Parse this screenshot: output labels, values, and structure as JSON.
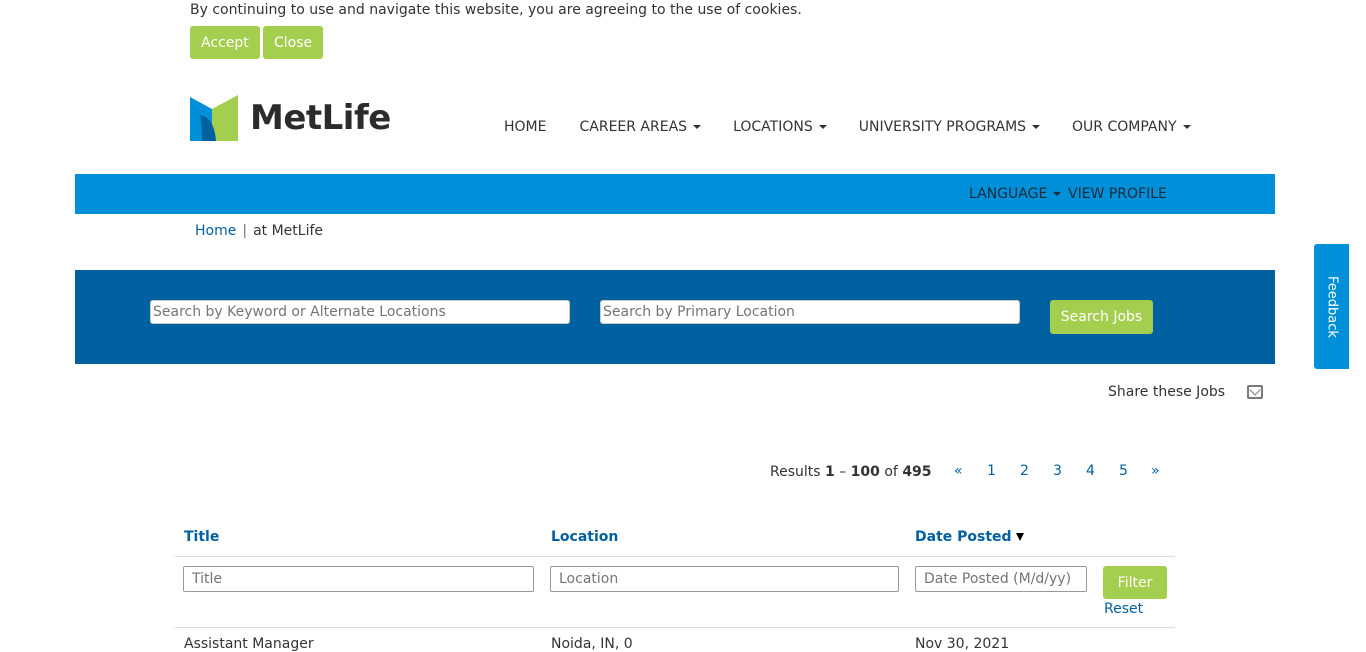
{
  "cookie": {
    "message": "By continuing to use and navigate this website, you are agreeing to the use of cookies.",
    "accept_label": "Accept",
    "close_label": "Close"
  },
  "brand": {
    "name": "MetLife"
  },
  "nav": {
    "items": [
      {
        "label": "HOME",
        "has_dropdown": false
      },
      {
        "label": "CAREER AREAS",
        "has_dropdown": true
      },
      {
        "label": "LOCATIONS",
        "has_dropdown": true
      },
      {
        "label": "UNIVERSITY PROGRAMS",
        "has_dropdown": true
      },
      {
        "label": "OUR COMPANY",
        "has_dropdown": true
      }
    ]
  },
  "utility": {
    "language_label": "LANGUAGE",
    "profile_label": "VIEW PROFILE"
  },
  "breadcrumb": {
    "home": "Home",
    "separator": "|",
    "current": "at MetLife"
  },
  "search": {
    "keyword_placeholder": "Search by Keyword or Alternate Locations",
    "location_placeholder": "Search by Primary Location",
    "button_label": "Search Jobs"
  },
  "share": {
    "label": "Share these Jobs"
  },
  "results": {
    "prefix": "Results",
    "start": "1",
    "dash": "–",
    "end": "100",
    "of": "of",
    "total": "495"
  },
  "pagination": [
    "«",
    "1",
    "2",
    "3",
    "4",
    "5",
    "»"
  ],
  "feedback": {
    "label": "Feedback"
  },
  "table": {
    "headers": {
      "title": "Title",
      "location": "Location",
      "date": "Date Posted"
    },
    "filters": {
      "title_placeholder": "Title",
      "location_placeholder": "Location",
      "date_placeholder": "Date Posted (M/d/yy)"
    },
    "filter_label": "Filter",
    "reset_label": "Reset",
    "first_row": {
      "title": "Assistant Manager",
      "location": "Noida, IN, 0",
      "date": "Nov 30, 2021"
    }
  },
  "colors": {
    "accent_green": "#a4ce4e",
    "util_blue": "#0090da",
    "search_blue": "#0061a0",
    "link_blue": "#0061a0"
  }
}
